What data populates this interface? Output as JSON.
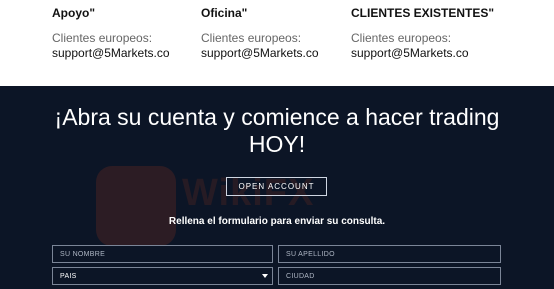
{
  "contacts": [
    {
      "heading": "Apoyo\"",
      "sub": "Clientes europeos:",
      "email": "support@5Markets.co"
    },
    {
      "heading": "Oficina\"",
      "sub": "Clientes europeos:",
      "email": "support@5Markets.co"
    },
    {
      "heading": "CLIENTES EXISTENTES\"",
      "sub": "Clientes europeos:",
      "email": "support@5Markets.co"
    }
  ],
  "cta": {
    "line1": "¡Abra su cuenta y comience a hacer trading",
    "line2": "HOY!"
  },
  "open_account_label": "OPEN ACCOUNT",
  "form_note": "Rellena el formulario para enviar su consulta.",
  "form": {
    "nombre_placeholder": "SU NOMBRE",
    "apellido_placeholder": "SU APELLIDO",
    "pais_selected": "PAIS",
    "ciudad_placeholder": "CIUDAD"
  },
  "watermark": {
    "text": "WikiFX"
  },
  "colors": {
    "band_bg": "#0c1526",
    "field_border": "#7b8597",
    "text_light": "#ffffff"
  }
}
